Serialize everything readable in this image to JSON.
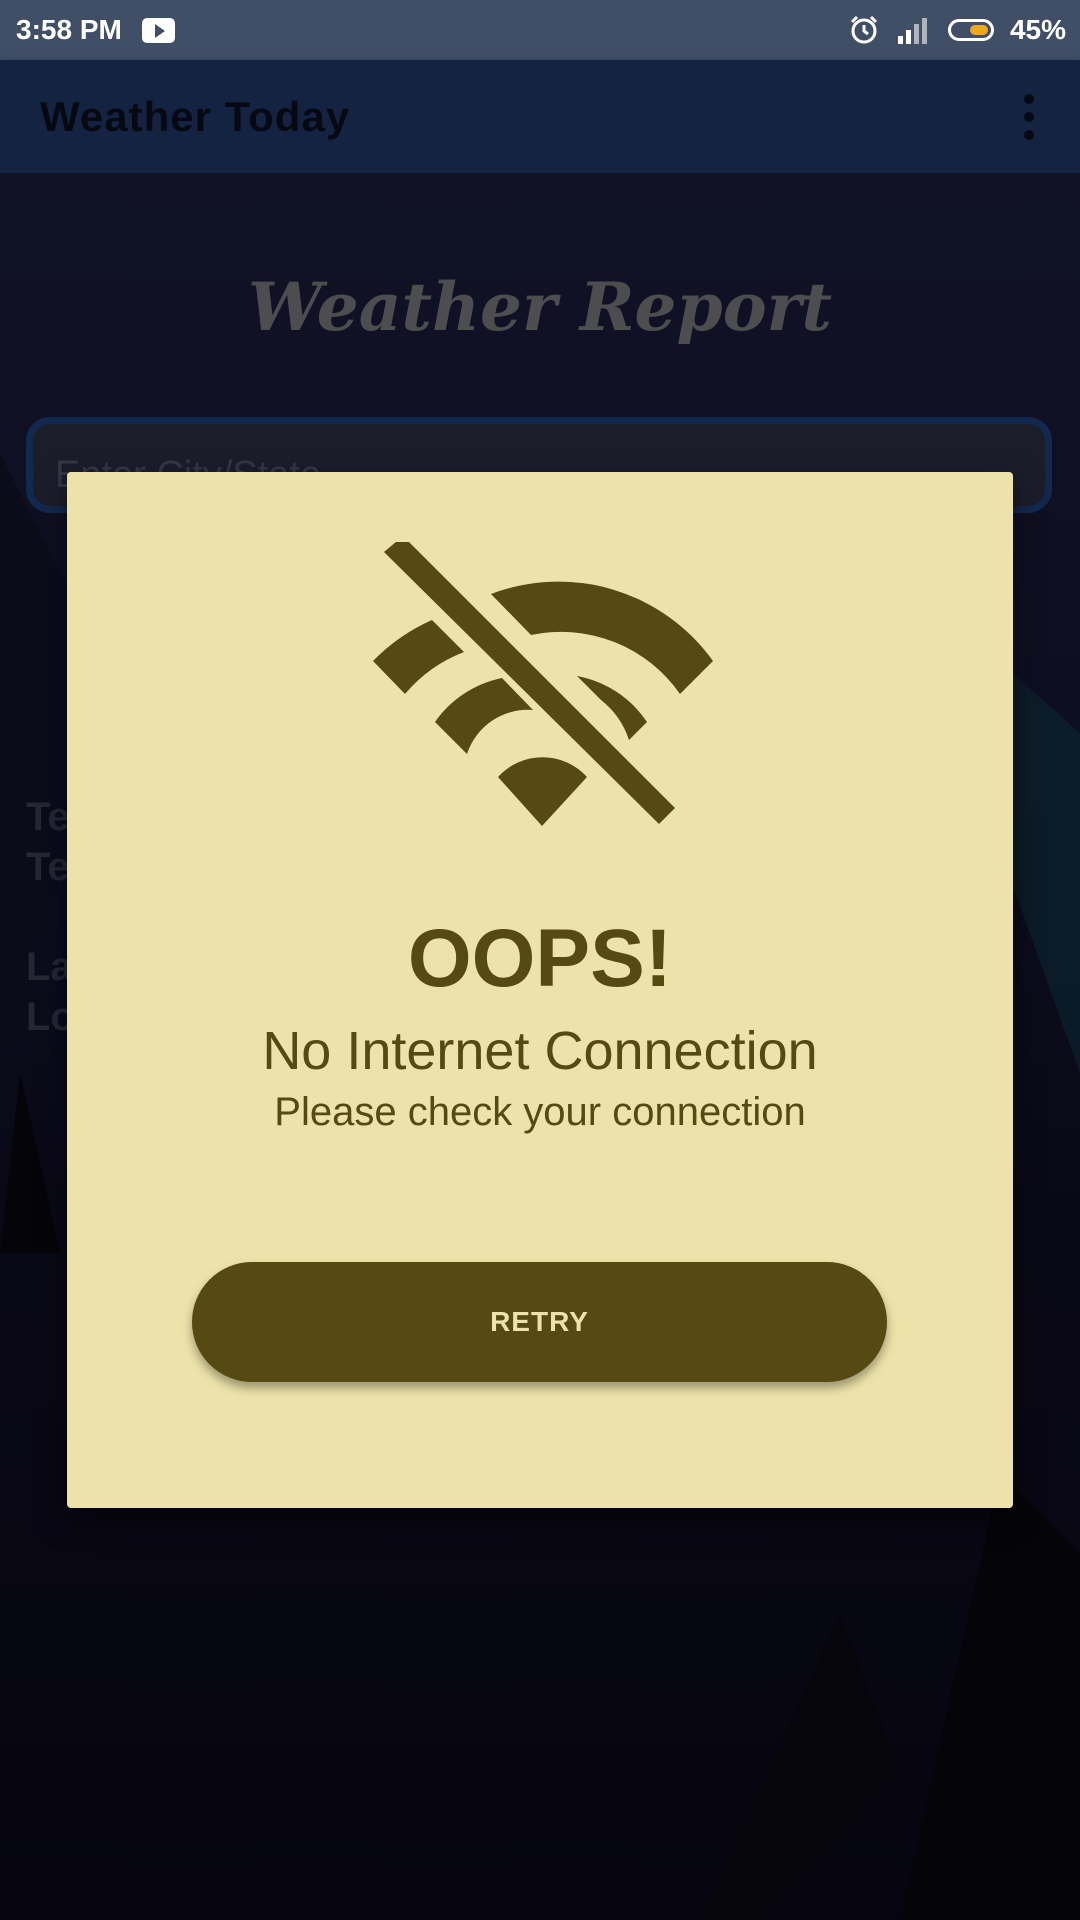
{
  "status_bar": {
    "time": "3:58 PM",
    "battery_percent": "45%",
    "icons": [
      "youtube-icon",
      "alarm-icon",
      "signal-icon",
      "battery-icon"
    ]
  },
  "app_bar": {
    "title": "Weather Today",
    "menu_icon": "overflow-menu-icon"
  },
  "background": {
    "report_title": "Weather Report",
    "city_input_placeholder": "Enter City/State",
    "labels": [
      "Te",
      "Te",
      "La",
      "Lo"
    ]
  },
  "dialog": {
    "icon": "wifi-off-icon",
    "heading": "OOPS!",
    "message": "No Internet Connection",
    "submessage": "Please check your connection",
    "retry_label": "RETRY"
  },
  "colors": {
    "dialog_bg": "#ede3aa",
    "accent": "#564912",
    "app_bar": "#1f3766",
    "status_bar": "#414f66"
  }
}
